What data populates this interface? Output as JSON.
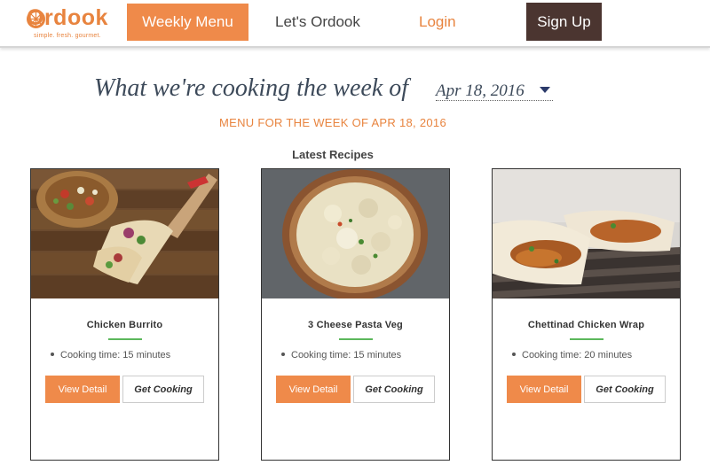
{
  "header": {
    "logo_text": "Ordook",
    "logo_tagline": "simple. fresh. gourmet.",
    "nav": {
      "weekly_menu": "Weekly Menu",
      "lets_ordook": "Let's Ordook",
      "login": "Login",
      "sign_up": "Sign Up"
    }
  },
  "week": {
    "heading": "What we're cooking the week of",
    "selected_date": "Apr 18, 2016",
    "subheading": "MENU FOR THE WEEK OF APR 18, 2016"
  },
  "latest_label": "Latest Recipes",
  "recipes": [
    {
      "title": "Chicken Burrito",
      "cooking_time": "Cooking time: 15 minutes",
      "view_label": "View Detail",
      "cook_label": "Get Cooking",
      "image": "chicken-burrito-photo"
    },
    {
      "title": "3 Cheese Pasta Veg",
      "cooking_time": "Cooking time: 15 minutes",
      "view_label": "View Detail",
      "cook_label": "Get Cooking",
      "image": "pasta-bowl-photo"
    },
    {
      "title": "Chettinad Chicken Wrap",
      "cooking_time": "Cooking time: 20 minutes",
      "view_label": "View Detail",
      "cook_label": "Get Cooking",
      "image": "chicken-wrap-photo"
    }
  ],
  "colors": {
    "accent": "#ef8a4a",
    "dark_button": "#4b3530",
    "heading_text": "#3d4a5a",
    "rule_green": "#5cb85c"
  }
}
